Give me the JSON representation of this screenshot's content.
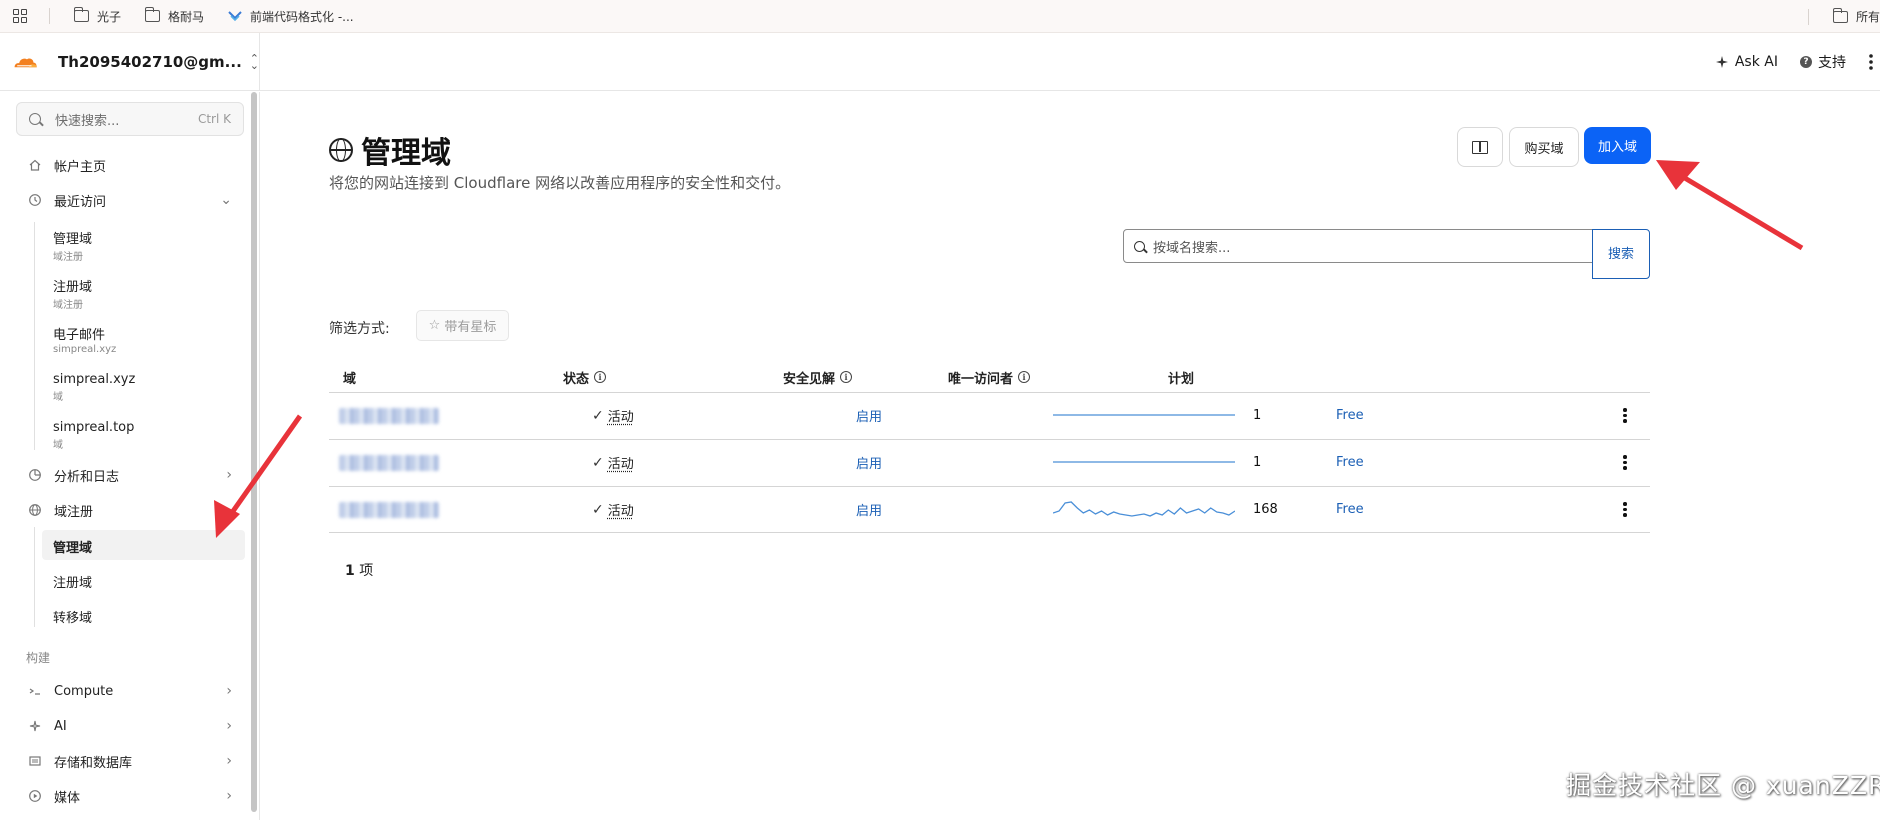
{
  "bookmarks": {
    "items": [
      {
        "label": "光子",
        "icon": "folder-icon"
      },
      {
        "label": "格耐马",
        "icon": "folder-icon"
      },
      {
        "label": "前端代码格式化 -...",
        "icon": "code-formatter-icon"
      }
    ],
    "right_label": "所有"
  },
  "header": {
    "account": "Th2095402710@gm...",
    "ask_ai": "Ask AI",
    "support": "支持"
  },
  "sidebar": {
    "search_placeholder": "快速搜索...",
    "search_shortcut": "Ctrl K",
    "items": [
      {
        "label": "帐户主页",
        "icon": "home-icon"
      },
      {
        "label": "最近访问",
        "icon": "history-icon"
      },
      {
        "label": "分析和日志",
        "icon": "chart-icon"
      },
      {
        "label": "域注册",
        "icon": "globe-icon"
      }
    ],
    "recent": [
      {
        "title": "管理域",
        "subtitle": "域注册"
      },
      {
        "title": "注册域",
        "subtitle": "域注册"
      },
      {
        "title": "电子邮件",
        "subtitle": "simpreal.xyz"
      },
      {
        "title": "simpreal.xyz",
        "subtitle": "域"
      },
      {
        "title": "simpreal.top",
        "subtitle": "域"
      }
    ],
    "domain_reg_sub": [
      "管理域",
      "注册域",
      "转移域"
    ],
    "section_build": "构建",
    "build_items": [
      {
        "label": "Compute",
        "icon": "compute-icon"
      },
      {
        "label": "AI",
        "icon": "ai-sparkle-icon"
      },
      {
        "label": "存储和数据库",
        "icon": "storage-icon"
      },
      {
        "label": "媒体",
        "icon": "media-icon"
      }
    ]
  },
  "main": {
    "title": "管理域",
    "subtitle": "将您的网站连接到 Cloudflare 网络以改善应用程序的安全性和交付。",
    "buy_label": "购买域",
    "add_label": "加入域",
    "search_placeholder": "按域名搜索...",
    "search_button": "搜索",
    "filter_label": "筛选方式:",
    "star_filter": "带有星标",
    "columns": [
      "域",
      "状态",
      "安全见解",
      "唯一访问者",
      "计划"
    ],
    "rows": [
      {
        "status": "活动",
        "security": "启用",
        "visitors": "1",
        "plan": "Free"
      },
      {
        "status": "活动",
        "security": "启用",
        "visitors": "1",
        "plan": "Free"
      },
      {
        "status": "活动",
        "security": "启用",
        "visitors": "168",
        "plan": "Free"
      }
    ],
    "count_num": "1",
    "count_unit": "项"
  },
  "colors": {
    "accent": "#0b63f6",
    "link": "#1b5fb5",
    "cloudflare_orange": "#f38020",
    "annotation_red": "#e8333a"
  },
  "watermark": "掘金技术社区 @ xuanZZR"
}
